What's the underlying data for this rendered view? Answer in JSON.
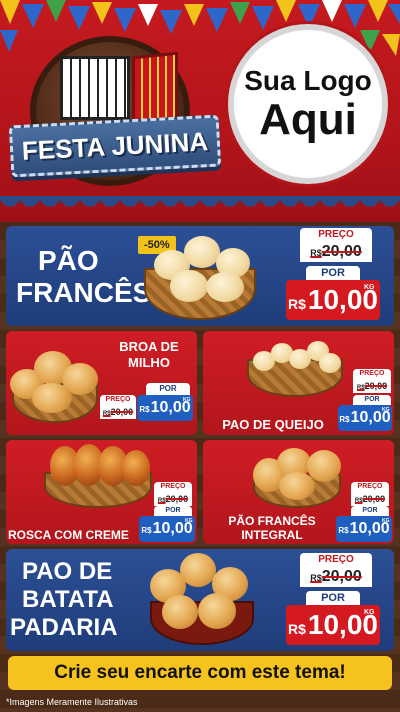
{
  "header": {
    "banner_text": "FESTA JUNINA",
    "logo_line1": "Sua Logo",
    "logo_line2": "Aqui"
  },
  "products": {
    "pao_frances": {
      "name_line1": "PÃO",
      "name_line2": "FRANCÊS",
      "badge": "-50%",
      "preco_label": "PREÇO",
      "old_currency": "R$",
      "old_price": "20,00",
      "por_label": "POR",
      "new_currency": "R$",
      "new_price": "10,00",
      "unit": "KG"
    },
    "broa_de_milho": {
      "name_line1": "BROA DE",
      "name_line2": "MILHO",
      "preco_label": "PREÇO",
      "old_currency": "R$",
      "old_price": "20,00",
      "por_label": "POR",
      "new_currency": "R$",
      "new_price": "10,00",
      "unit": "KG"
    },
    "pao_de_queijo": {
      "name": "PAO DE QUEIJO",
      "preco_label": "PREÇO",
      "old_currency": "R$",
      "old_price": "20,00",
      "por_label": "POR",
      "new_currency": "R$",
      "new_price": "10,00",
      "unit": "KG"
    },
    "rosca_com_creme": {
      "name": "ROSCA COM CREME",
      "preco_label": "PREÇO",
      "old_currency": "R$",
      "old_price": "20,00",
      "por_label": "POR",
      "new_currency": "R$",
      "new_price": "10,00",
      "unit": "KG"
    },
    "pao_frances_integral": {
      "name_line1": "PÃO FRANCÊS",
      "name_line2": "INTEGRAL",
      "preco_label": "PREÇO",
      "old_currency": "R$",
      "old_price": "20,00",
      "por_label": "POR",
      "new_currency": "R$",
      "new_price": "10,00",
      "unit": "KG"
    },
    "pao_de_batata": {
      "name_line1": "PAO DE",
      "name_line2": "BATATA",
      "name_line3": "PADARIA",
      "preco_label": "PREÇO",
      "old_currency": "R$",
      "old_price": "20,00",
      "por_label": "POR",
      "new_currency": "R$",
      "new_price": "10,00",
      "unit": "KG"
    }
  },
  "footer": {
    "cta": "Crie seu encarte com este tema!",
    "disclaimer": "*Imagens Meramente Ilustrativas"
  },
  "colors": {
    "red": "#c41a1f",
    "blue": "#1f3d7a",
    "yellow": "#f6c21d",
    "wood": "#4b2a17"
  }
}
